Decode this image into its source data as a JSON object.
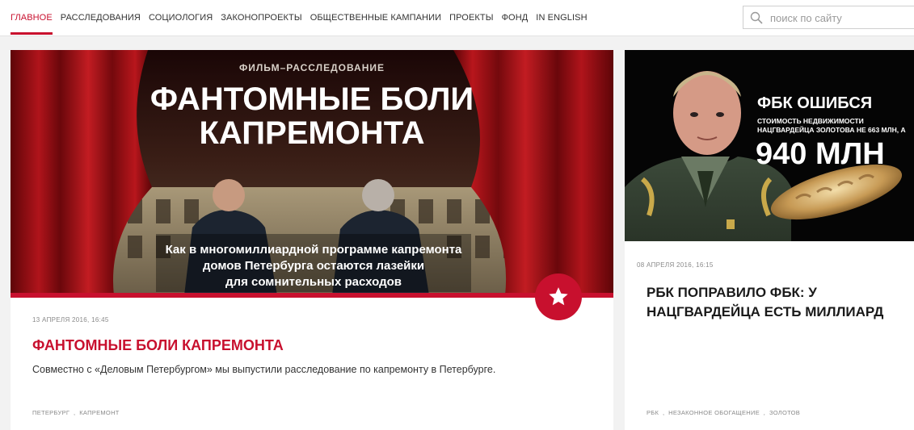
{
  "nav": {
    "items": [
      {
        "label": "ГЛАВНОЕ",
        "active": true
      },
      {
        "label": "РАССЛЕДОВАНИЯ",
        "active": false
      },
      {
        "label": "СОЦИОЛОГИЯ",
        "active": false
      },
      {
        "label": "ЗАКОНОПРОЕКТЫ",
        "active": false
      },
      {
        "label": "ОБЩЕСТВЕННЫЕ КАМПАНИИ",
        "active": false
      },
      {
        "label": "ПРОЕКТЫ",
        "active": false
      },
      {
        "label": "ФОНД",
        "active": false
      },
      {
        "label": "IN ENGLISH",
        "active": false
      }
    ]
  },
  "search": {
    "placeholder": "поиск по сайту",
    "value": ""
  },
  "colors": {
    "accent": "#c8102e",
    "curtain": "#8e0f14",
    "text": "#1a1a1a",
    "muted": "#8a8a8a"
  },
  "main_article": {
    "image": {
      "kicker": "ФИЛЬМ–РАССЛЕДОВАНИЕ",
      "title_line1": "ФАНТОМНЫЕ БОЛИ",
      "title_line2": "КАПРЕМОНТА",
      "caption_line1": "Как в многомиллиардной программе капремонта",
      "caption_line2": "домов Петербурга остаются лазейки",
      "caption_line3": "для сомнительных расходов"
    },
    "badge_icon": "star-icon",
    "date": "13 АПРЕЛЯ 2016, 16:45",
    "title": "ФАНТОМНЫЕ БОЛИ КАПРЕМОНТА",
    "lede": "Совместно с «Деловым Петербургом» мы выпустили расследование по капремонту в Петербурге.",
    "tags": [
      "ПЕТЕРБУРГ",
      "КАПРЕМОНТ"
    ]
  },
  "side_article": {
    "image": {
      "title": "ФБК ОШИБСЯ",
      "sub_line1": "СТОИМОСТЬ НЕДВИЖИМОСТИ",
      "sub_line2": "НАЦГВАРДЕЙЦА ЗОЛОТОВА НЕ 663 МЛН, А",
      "amount": "940 МЛН"
    },
    "date": "08 АПРЕЛЯ 2016, 16:15",
    "title": "РБК ПОПРАВИЛО ФБК: У НАЦГВАРДЕЙЦА ЕСТЬ МИЛЛИАРД",
    "tags": [
      "РБК",
      "НЕЗАКОННОЕ ОБОГАЩЕНИЕ",
      "ЗОЛОТОВ"
    ]
  }
}
